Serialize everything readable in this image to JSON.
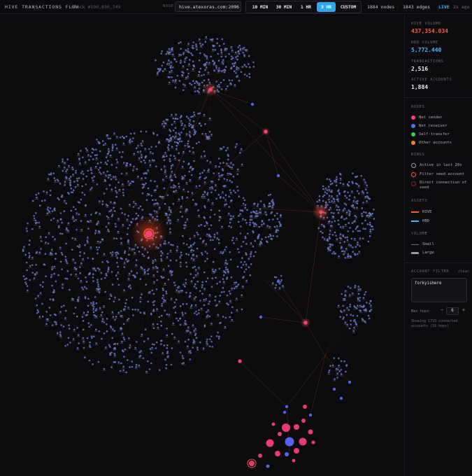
{
  "header": {
    "title": "HIVE TRANSACTIONS FLOW",
    "block": "Block #100,830,749",
    "node_label": "NODE",
    "node_value": "hive.atexoras.com:2096",
    "time_ranges": [
      {
        "label": "10 MIN",
        "active": false
      },
      {
        "label": "30 MIN",
        "active": false
      },
      {
        "label": "1 HR",
        "active": false
      },
      {
        "label": "3 HR",
        "active": true
      },
      {
        "label": "CUSTOM",
        "active": false
      }
    ],
    "nodes_stat": "1884 nodes",
    "separator": "·",
    "edges_stat": "1843 edges",
    "live": "LIVE",
    "updated": "2s ago"
  },
  "metrics": [
    {
      "label": "HIVE VOLUME",
      "value": "437,354.034",
      "color": "#ff5a3c"
    },
    {
      "label": "HBD VOLUME",
      "value": "5,772.440",
      "color": "#42b8f5"
    },
    {
      "label": "TRANSACTIONS",
      "value": "2,516",
      "color": "#ececf0"
    },
    {
      "label": "ACTIVE ACCOUNTS",
      "value": "1,884",
      "color": "#ececf0"
    }
  ],
  "legend": {
    "nodes_title": "NODES",
    "nodes": [
      {
        "label": "Net sender",
        "color": "#ff3d7f"
      },
      {
        "label": "Net receiver",
        "color": "#5b6cff"
      },
      {
        "label": "Self-transfer",
        "color": "#39d353"
      },
      {
        "label": "Other accounts",
        "color": "#ff7a2f"
      }
    ],
    "rings_title": "RINGS",
    "rings": [
      {
        "label": "Active in last 20s",
        "color": "#9a9aa4"
      },
      {
        "label": "Filter seed account",
        "color": "#ff5a3c"
      },
      {
        "label": "Direct connection of seed",
        "color": "#8a2a3a"
      }
    ],
    "assets_title": "ASSETS",
    "assets": [
      {
        "label": "HIVE",
        "color": "#ff5a3c"
      },
      {
        "label": "HBD",
        "color": "#42b8f5"
      }
    ],
    "volume_title": "VOLUME",
    "volume": [
      {
        "label": "Small"
      },
      {
        "label": "Large"
      }
    ]
  },
  "filter": {
    "title": "ACCOUNT FILTER",
    "clear": "clear",
    "value": "forkyishere",
    "max_hops_label": "Max hops",
    "minus": "−",
    "hops": "6",
    "plus": "+",
    "status": "Showing 1716 connected accounts (16 hops)"
  },
  "colors": {
    "sender": "#ff3d7f",
    "receiver": "#5b6cff",
    "hive_edge": "#ff5a3c",
    "hbd_edge": "#42b8f5",
    "node_fill": "#6f7fd9"
  }
}
